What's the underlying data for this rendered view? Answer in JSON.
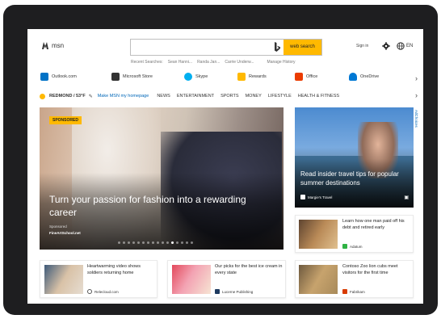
{
  "header": {
    "logo_text": "msn",
    "search": {
      "placeholder": "",
      "button_label": "web search"
    },
    "recent_label": "Recent Searches:",
    "recent_items": [
      "Sean Hanni...",
      "Randa Jan...",
      "Carrie Underw..."
    ],
    "manage_history": "Manage History",
    "signin": "Sign in",
    "language": "EN"
  },
  "quicklinks": [
    {
      "label": "Outlook.com",
      "icon": "outlook-icon",
      "color": "#0072c6"
    },
    {
      "label": "Microsoft Store",
      "icon": "store-icon",
      "color": "#333333"
    },
    {
      "label": "Skype",
      "icon": "skype-icon",
      "color": "#00aff0"
    },
    {
      "label": "Rewards",
      "icon": "rewards-icon",
      "color": "#ffb900"
    },
    {
      "label": "Office",
      "icon": "office-icon",
      "color": "#eb3c00"
    },
    {
      "label": "OneDrive",
      "icon": "onedrive-icon",
      "color": "#0078d4"
    }
  ],
  "nav": {
    "location": "REDMOND / 53°F",
    "homepage_link": "Make MSN my homepage",
    "items": [
      "NEWS",
      "ENTERTAINMENT",
      "SPORTS",
      "MONEY",
      "LIFESTYLE",
      "HEALTH & FITNESS"
    ]
  },
  "hero": {
    "badge": "SPONSORED",
    "title": "Turn your passion for fashion into a rewarding career",
    "sponsored_label": "Sponsored",
    "source": "FineArtSchool.net",
    "dot_count": 16,
    "active_dot": 11
  },
  "travel": {
    "title": "Read insider travel tips for popular summer destinations",
    "source": "Margie's Travel",
    "adchoices": "AdChoices"
  },
  "cards": {
    "debt": {
      "title": "Learn how one man paid off his debt and retired early",
      "source": "Adatum"
    },
    "video": {
      "title": "Heartwarming video shows soldiers returning home",
      "source": "Relecloud.com"
    },
    "icecream": {
      "title": "Our picks for the best ice cream in every state",
      "source": "Lucerne Publishing"
    },
    "lion": {
      "title": "Contoso Zoo lion cubs meet visitors for the first time",
      "source": "Fabrikam"
    }
  },
  "colors": {
    "accent": "#ffb900",
    "link": "#0067b8",
    "device": "#1e1e20"
  }
}
